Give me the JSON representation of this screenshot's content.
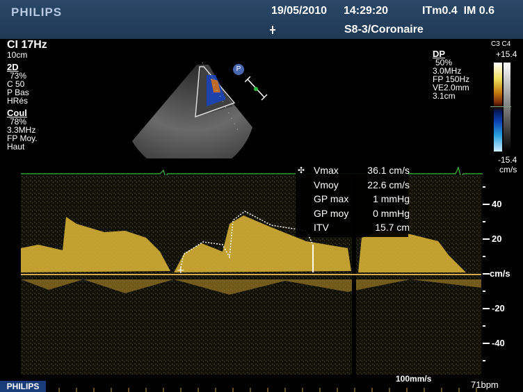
{
  "header": {
    "brand": "PHILIPS",
    "date": "19/05/2010",
    "time": "14:29:20",
    "indices": "ITm0.4  IM 0.6",
    "probe_preset": "S8-3/Coronaire"
  },
  "left_panel": {
    "mode": "CI 17Hz",
    "depth": "10cm",
    "section_2d": {
      "title": "2D",
      "gain": "73%",
      "compression": "C 50",
      "power": "P Bas",
      "resolution": "HRés"
    },
    "section_color": {
      "title": "Coul",
      "gain": "78%",
      "frequency": "3.3MHz",
      "filter": "FP Moy.",
      "setting": "Haut"
    }
  },
  "right_panel": {
    "title": "DP",
    "gain": "50%",
    "frequency": "3.0MHz",
    "filter": "FP 150Hz",
    "volume": "VE2.0mm",
    "depth": "3.1cm",
    "color_label": "C3 C4",
    "scale_top": "+15.4",
    "scale_bottom": "-15.4",
    "scale_unit": "cm/s"
  },
  "measurements": {
    "vmax_label": "Vmax",
    "vmax_value": "36.1 cm/s",
    "vmoy_label": "Vmoy",
    "vmoy_value": "22.6 cm/s",
    "gpmax_label": "GP max",
    "gpmax_value": "1 mmHg",
    "gpmoy_label": "GP moy",
    "gpmoy_value": "0 mmHg",
    "itv_label": "ITV",
    "itv_value": "15.7 cm"
  },
  "axis": {
    "t40": "40",
    "t20": "20",
    "unit": "cm/s",
    "tm20": "-20",
    "tm40": "-40"
  },
  "footer": {
    "brand": "PHILIPS",
    "sweep_speed": "100mm/s",
    "heart_rate": "71bpm"
  },
  "colors": {
    "header_bg": "#2b4868",
    "ecg_trace": "#3fbf3f",
    "doppler_signal": "#e8c440",
    "trace_dots": "#ffffff",
    "baseline": "#d0aa50"
  }
}
